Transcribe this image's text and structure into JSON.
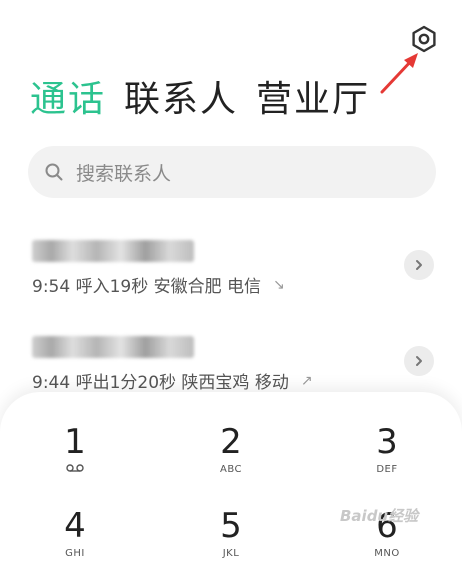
{
  "tabs": [
    {
      "label": "通话",
      "active": true
    },
    {
      "label": "联系人",
      "active": false
    },
    {
      "label": "营业厅",
      "active": false
    }
  ],
  "search": {
    "placeholder": "搜索联系人",
    "icon": "search-icon"
  },
  "settings": {
    "icon": "gear-icon"
  },
  "annotation": {
    "icon": "red-arrow",
    "color": "#e53935"
  },
  "accent_color": "#2cc38f",
  "calls": [
    {
      "detail": "9:54 呼入19秒 安徽合肥 电信",
      "direction": "incoming",
      "direction_glyph": "↘"
    },
    {
      "detail": "9:44 呼出1分20秒 陕西宝鸡 移动",
      "direction": "outgoing",
      "direction_glyph": "↗"
    }
  ],
  "dialpad": [
    {
      "digit": "1",
      "letters": "voicemail-icon"
    },
    {
      "digit": "2",
      "letters": "ABC"
    },
    {
      "digit": "3",
      "letters": "DEF"
    },
    {
      "digit": "4",
      "letters": "GHI"
    },
    {
      "digit": "5",
      "letters": "JKL"
    },
    {
      "digit": "6",
      "letters": "MNO"
    }
  ],
  "watermark": "Baidu经验"
}
